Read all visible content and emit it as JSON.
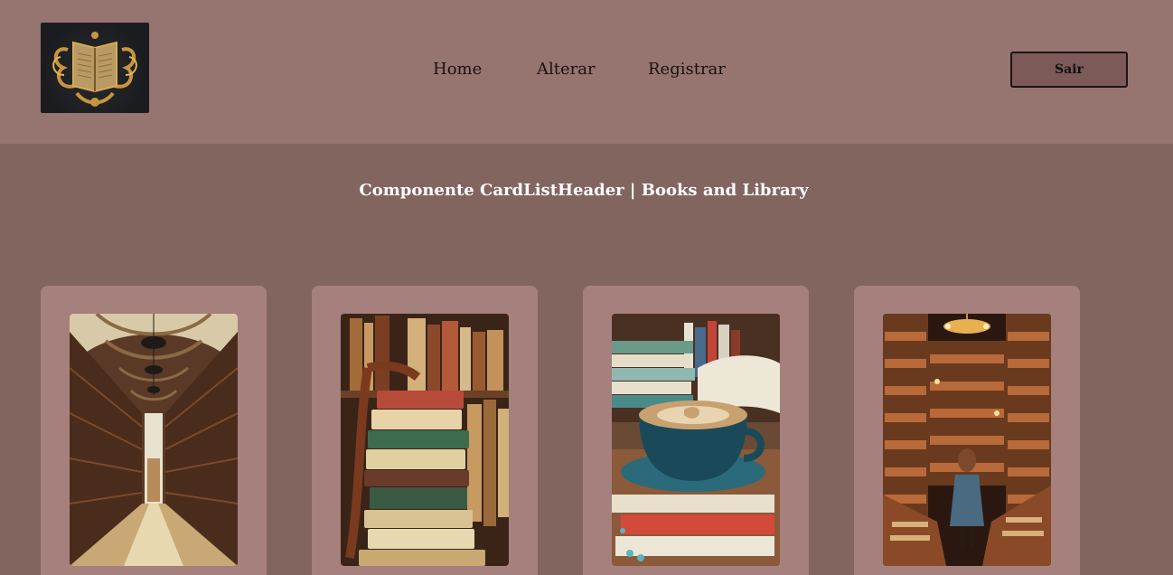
{
  "nav": {
    "items": [
      {
        "label": "Home"
      },
      {
        "label": "Alterar"
      },
      {
        "label": "Registrar"
      }
    ],
    "logout_label": "Sair"
  },
  "section": {
    "title": "Componente CardListHeader | Books and Library"
  },
  "cards": [
    {
      "image": "library-hall-image"
    },
    {
      "image": "book-stack-image"
    },
    {
      "image": "coffee-books-image"
    },
    {
      "image": "reader-library-image"
    }
  ],
  "colors": {
    "header_bg": "#96746f",
    "page_bg": "#836560",
    "card_bg": "#a5807c",
    "button_bg": "#7b5a58"
  }
}
